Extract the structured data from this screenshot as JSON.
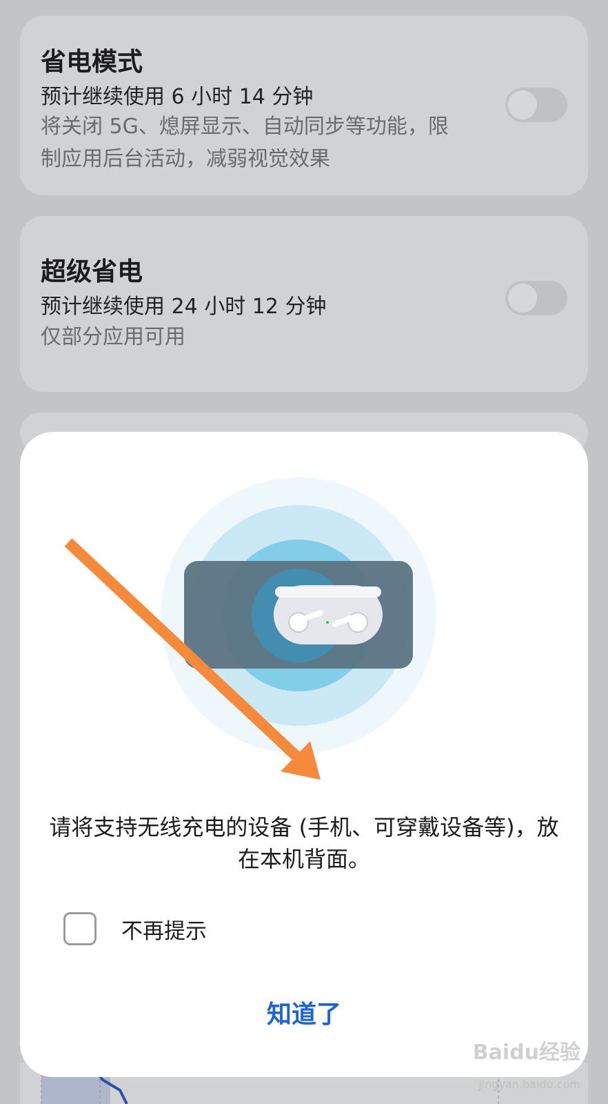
{
  "power_saving": {
    "title": "省电模式",
    "estimate": "预计继续使用 6 小时 14 分钟",
    "description": "将关闭 5G、熄屏显示、自动同步等功能，限制应用后台活动，减弱视觉效果",
    "toggle_on": false
  },
  "super_saving": {
    "title": "超级省电",
    "estimate": "预计继续使用 24 小时 12 分钟",
    "description": "仅部分应用可用",
    "toggle_on": false
  },
  "dialog": {
    "message": "请将支持无线充电的设备 (手机、可穿戴设备等)，放在本机背面。",
    "checkbox_label": "不再提示",
    "checkbox_checked": false,
    "confirm_label": "知道了",
    "illustration_icon": "wireless-reverse-charging-earbuds-icon"
  },
  "overlay_arrow": "orange-annotation-arrow",
  "watermark": {
    "brand": "Baidu经验",
    "url": "jingyan.baidu.com"
  },
  "colors": {
    "accent": "#1e63d6",
    "arrow": "#f58a3c",
    "dim_background": "#c3c4c6"
  }
}
